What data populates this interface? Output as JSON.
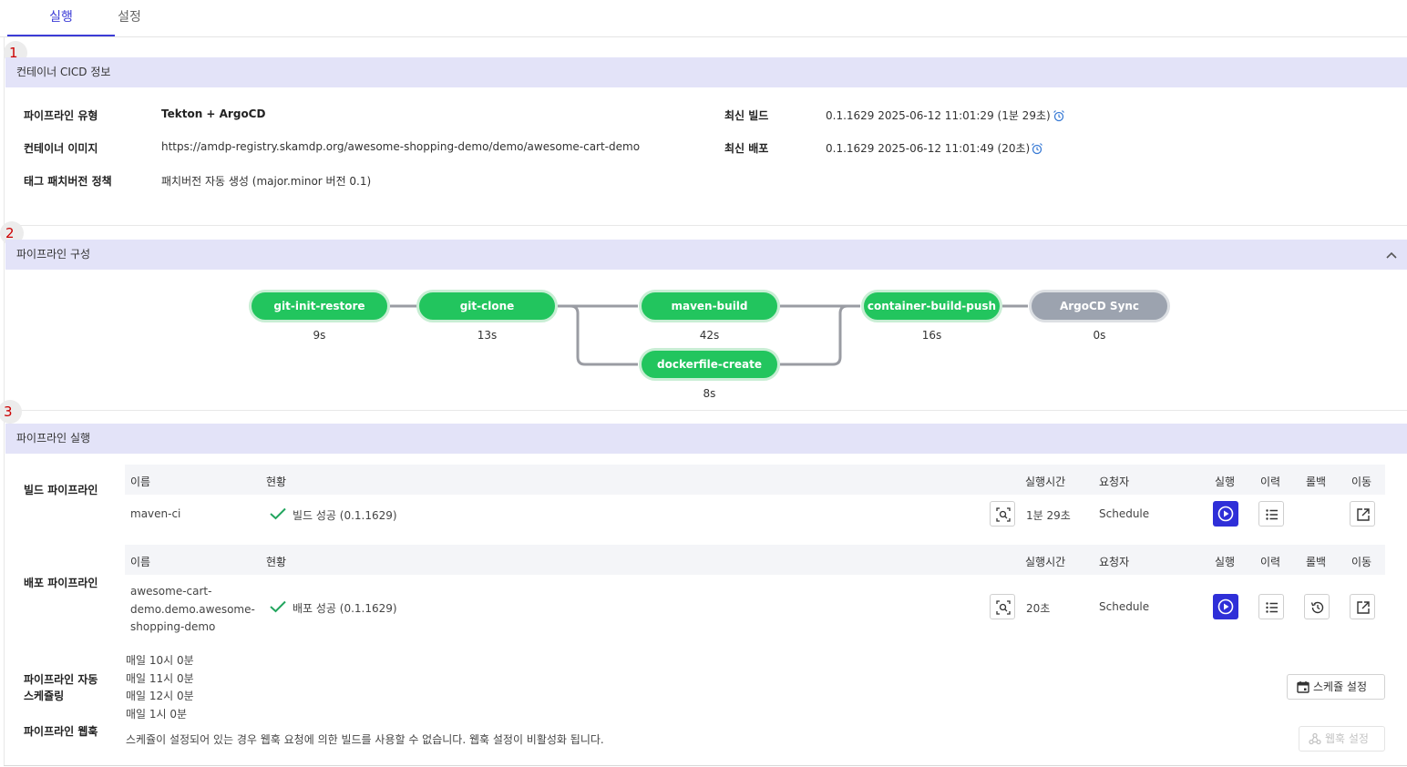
{
  "tabs": {
    "run": "실행",
    "settings": "설정"
  },
  "badges": [
    "1",
    "2",
    "3"
  ],
  "section1": {
    "title": "컨테이너 CICD 정보",
    "pipeline_type_label": "파이프라인 유형",
    "pipeline_type_value": "Tekton + ArgoCD",
    "container_image_label": "컨테이너 이미지",
    "container_image_value": "https://amdp-registry.skamdp.org/awesome-shopping-demo/demo/awesome-cart-demo",
    "tag_policy_label": "태그 패치버전 정책",
    "tag_policy_value": "패치버전 자동 생성 (major.minor 버전 0.1)",
    "latest_build_label": "최신 빌드",
    "latest_build_value": "0.1.1629 2025-06-12 11:01:29 (1분 29초)",
    "latest_deploy_label": "최신 배포",
    "latest_deploy_value": "0.1.1629 2025-06-12 11:01:49 (20초)",
    "icons": {
      "alarm": "alarm-clock-icon"
    }
  },
  "section2": {
    "title": "파이프라인 구성",
    "collapse_icon": "chevron-up-icon",
    "nodes": [
      {
        "name": "git-init-restore",
        "duration": "9s",
        "status": "success"
      },
      {
        "name": "git-clone",
        "duration": "13s",
        "status": "success"
      },
      {
        "name": "maven-build",
        "duration": "42s",
        "status": "success"
      },
      {
        "name": "dockerfile-create",
        "duration": "8s",
        "status": "success"
      },
      {
        "name": "container-build-push",
        "duration": "16s",
        "status": "success"
      },
      {
        "name": "ArgoCD Sync",
        "duration": "0s",
        "status": "pending"
      }
    ],
    "colors": {
      "success": "#22c55e",
      "pending": "#9ca3af",
      "connector": "#9a9ca3"
    }
  },
  "section3": {
    "title": "파이프라인 실행",
    "headers": {
      "name": "이름",
      "status": "현황",
      "runtime": "실행시간",
      "requester": "요청자",
      "run": "실행",
      "history": "이력",
      "rollback": "롤백",
      "goto": "이동"
    },
    "build": {
      "label": "빌드 파이프라인",
      "name": "maven-ci",
      "status": "빌드 성공 (0.1.1629)",
      "runtime": "1분 29초",
      "requester": "Schedule"
    },
    "deploy": {
      "label": "배포 파이프라인",
      "name_lines": [
        "awesome-cart-",
        "demo.demo.awesome-",
        "shopping-demo"
      ],
      "status": "배포 성공 (0.1.1629)",
      "runtime": "20초",
      "requester": "Schedule"
    },
    "schedule": {
      "label": "파이프라인 자동 스케쥴링",
      "entries": [
        "매일 10시 0분",
        "매일 11시 0분",
        "매일 12시 0분",
        "매일 1시 0분"
      ],
      "button": "스케쥴 설정"
    },
    "webhook": {
      "label": "파이프라인 웹훅",
      "message": "스케쥴이 설정되어 있는 경우 웹훅 요청에 의한 빌드를 사용할 수 없습니다. 웹훅 설정이 비활성화 됩니다.",
      "button": "웹훅 설정"
    },
    "colors": {
      "accent": "#2f2fd8",
      "success_check": "#22a55e"
    },
    "icons": [
      "log-search-icon",
      "play-circle-icon",
      "list-icon",
      "history-icon",
      "external-link-icon",
      "calendar-icon",
      "webhook-icon",
      "check-icon"
    ]
  }
}
